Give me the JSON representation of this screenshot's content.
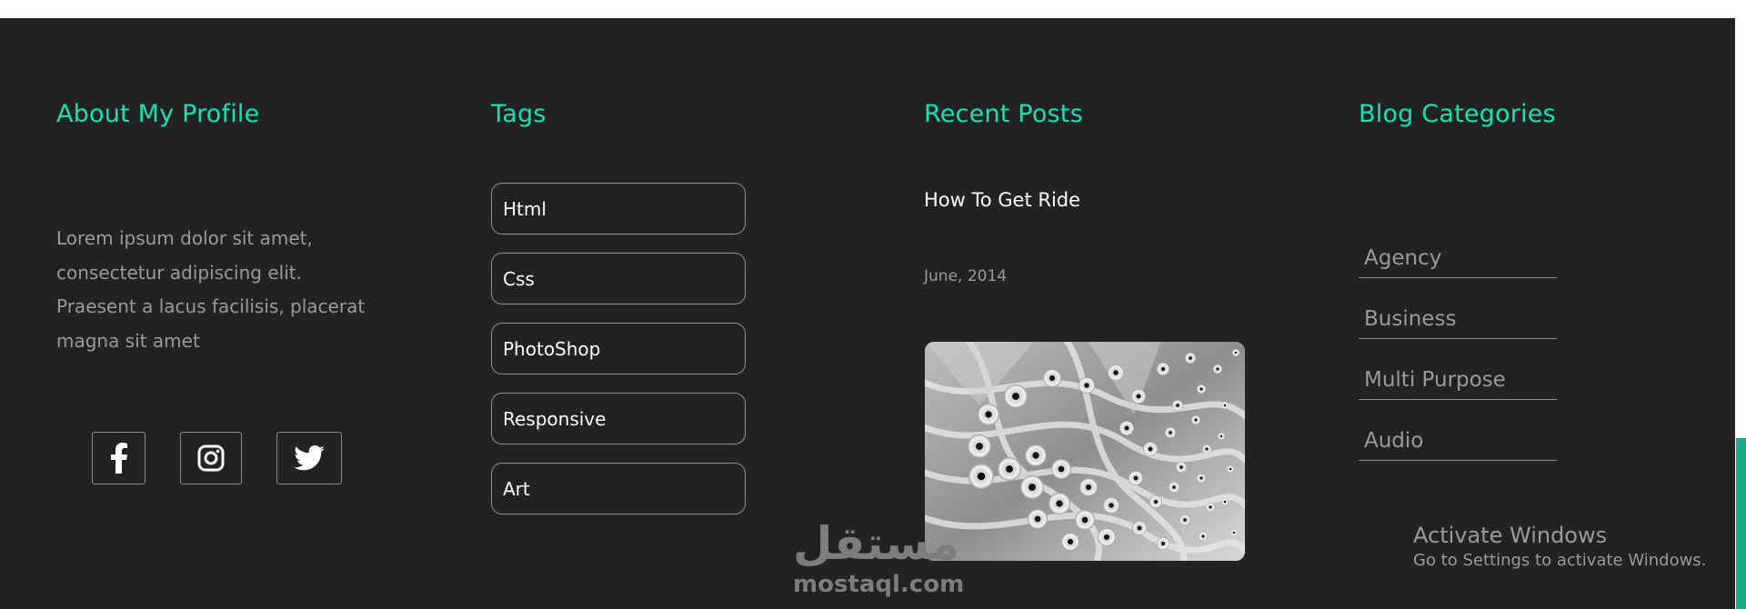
{
  "about": {
    "heading": "About My Profile",
    "text": "Lorem ipsum dolor sit amet, consectetur adipiscing elit. Praesent a lacus facilisis, placerat magna sit amet",
    "social": [
      "facebook-icon",
      "instagram-icon",
      "twitter-icon"
    ]
  },
  "tags": {
    "heading": "Tags",
    "items": [
      "Html",
      "Css",
      "PhotoShop",
      "Responsive",
      "Art"
    ]
  },
  "recent_posts": {
    "heading": "Recent Posts",
    "post_title": "How To Get Ride",
    "post_date": "June, 2014"
  },
  "categories": {
    "heading": "Blog Categories",
    "items": [
      "Agency",
      "Business",
      "Multi Purpose",
      "Audio"
    ]
  },
  "watermark": {
    "arabic": "مستقل",
    "latin": "mostaql.com"
  },
  "windows_notice": {
    "title": "Activate Windows",
    "subtitle": "Go to Settings to activate Windows."
  },
  "colors": {
    "background": "#222222",
    "accent": "#19e0b0",
    "scroll_thumb": "#1aa98a"
  }
}
